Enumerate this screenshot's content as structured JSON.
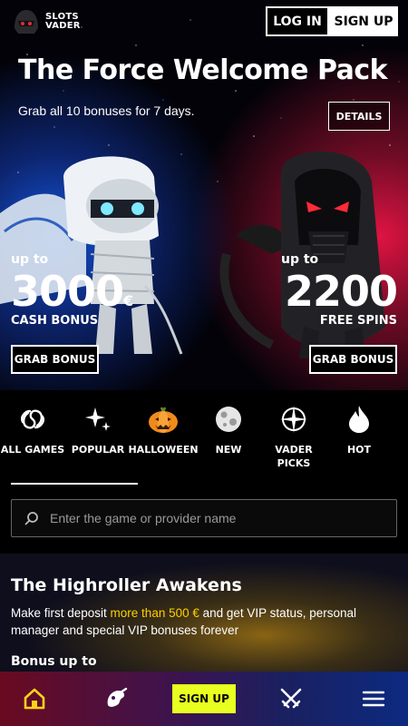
{
  "header": {
    "logo_line1": "SLOTS",
    "logo_line2": "VADER",
    "login_label": "LOG IN",
    "signup_label": "SIGN UP"
  },
  "hero": {
    "title": "The Force Welcome Pack",
    "subtitle": "Grab all 10 bonuses for 7 days.",
    "details_label": "DETAILS",
    "left": {
      "upto": "up to",
      "amount": "3000",
      "currency": "€",
      "label": "CASH BONUS",
      "button": "GRAB BONUS"
    },
    "right": {
      "upto": "up to",
      "amount": "2200",
      "label": "FREE SPINS",
      "button": "GRAB BONUS"
    }
  },
  "categories": [
    {
      "label": "ALL GAMES",
      "icon": "galaxy-icon",
      "active": true
    },
    {
      "label": "POPULAR",
      "icon": "sparkles-icon"
    },
    {
      "label": "HALLOWEEN",
      "icon": "pumpkin-icon"
    },
    {
      "label": "NEW",
      "icon": "moon-icon"
    },
    {
      "label": "VADER PICKS",
      "icon": "compass-star-icon"
    },
    {
      "label": "HOT",
      "icon": "flame-icon"
    }
  ],
  "search": {
    "placeholder": "Enter the game or provider name"
  },
  "promo": {
    "title": "The Highroller Awakens",
    "text_before": "Make first deposit ",
    "text_highlight": "more than 500 €",
    "text_after": " and get VIP status, personal manager and special VIP bonuses forever",
    "bonus_heading": "Bonus up to"
  },
  "bottom_nav": {
    "signup_label": "SIGN UP",
    "items": [
      "home-icon",
      "games-icon",
      "swords-icon",
      "menu-icon"
    ]
  },
  "colors": {
    "accent_yellow": "#e8ff1f",
    "highlight": "#ffd000",
    "hero_blue": "#1e5ae6",
    "hero_red": "#eb1446"
  }
}
